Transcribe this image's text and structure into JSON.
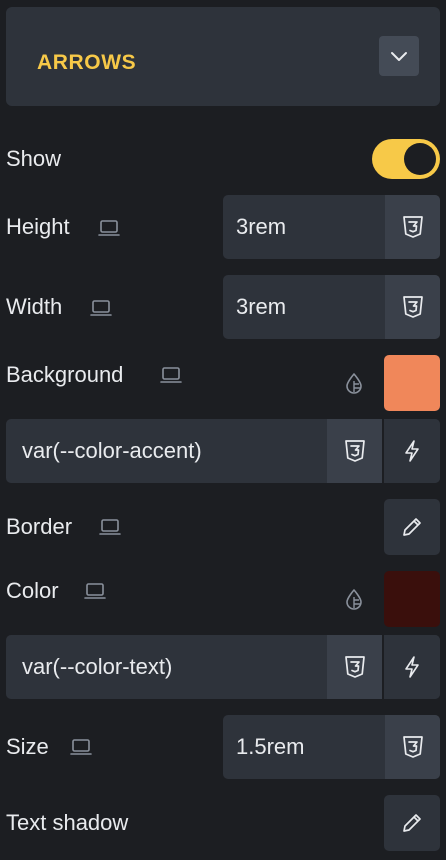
{
  "section": {
    "title": "ARROWS",
    "collapse_icon": "chevron-down-icon"
  },
  "colors": {
    "accent": "#f7c948",
    "background_swatch": "#f0875a",
    "color_swatch": "#3a0f0c"
  },
  "controls": {
    "show": {
      "label": "Show",
      "toggle_on": true
    },
    "height": {
      "label": "Height",
      "value": "3rem"
    },
    "width": {
      "label": "Width",
      "value": "3rem"
    },
    "background": {
      "label": "Background",
      "value": "var(--color-accent)"
    },
    "border": {
      "label": "Border"
    },
    "color": {
      "label": "Color",
      "value": "var(--color-text)"
    },
    "size": {
      "label": "Size",
      "value": "1.5rem"
    },
    "text_shadow": {
      "label": "Text shadow"
    }
  },
  "icons": {
    "breakpoint": "laptop-icon",
    "css": "css3-icon",
    "dynamic": "bolt-icon",
    "color_picker": "drop-icon",
    "edit": "pencil-icon"
  }
}
